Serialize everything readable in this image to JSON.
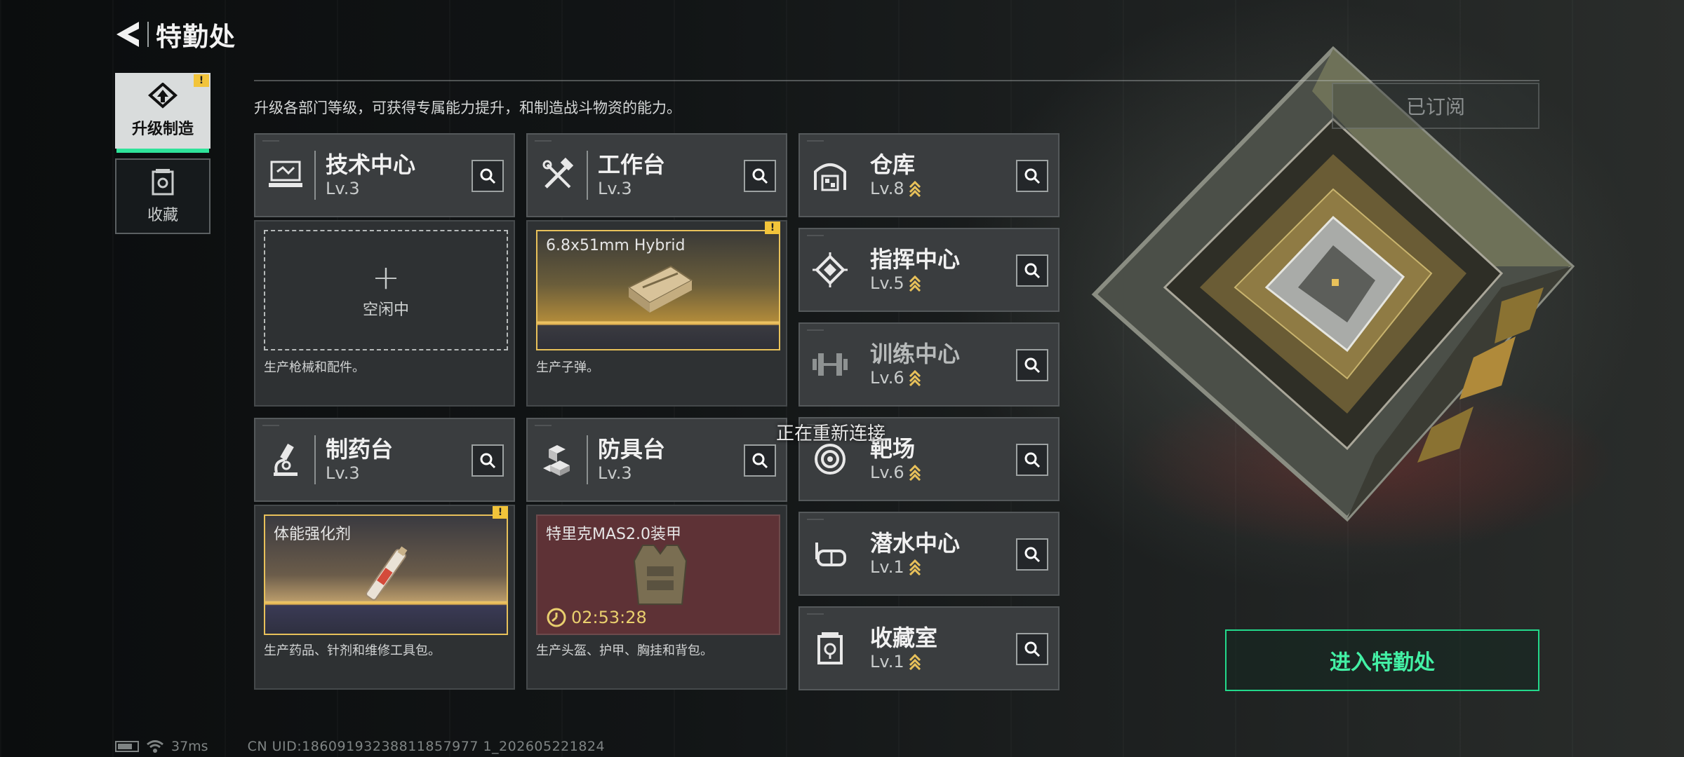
{
  "header": {
    "title": "特勤处"
  },
  "sidebar": {
    "items": [
      {
        "label": "升级制造",
        "active": true,
        "badge": "!"
      },
      {
        "label": "收藏",
        "active": false
      }
    ]
  },
  "description": "升级各部门等级，可获得专属能力提升，和制造战斗物资的能力。",
  "subscribe_button": "已订阅",
  "departments": {
    "tech_center": {
      "name": "技术中心",
      "level": "Lv.3",
      "slot_label": "空闲中",
      "desc": "生产枪械和配件。"
    },
    "workbench": {
      "name": "工作台",
      "level": "Lv.3",
      "slot_item": "6.8x51mm Hybrid",
      "desc": "生产子弹。"
    },
    "pharmacy": {
      "name": "制药台",
      "level": "Lv.3",
      "slot_item": "体能强化剂",
      "desc": "生产药品、针剂和维修工具包。"
    },
    "armor_bench": {
      "name": "防具台",
      "level": "Lv.3",
      "slot_item": "特里克MAS2.0装甲",
      "timer": "02:53:28",
      "desc": "生产头盔、护甲、胸挂和背包。"
    },
    "warehouse": {
      "name": "仓库",
      "level": "Lv.8"
    },
    "command_center": {
      "name": "指挥中心",
      "level": "Lv.5"
    },
    "training_center": {
      "name": "训练中心",
      "level": "Lv.6"
    },
    "shooting_range": {
      "name": "靶场",
      "level": "Lv.6"
    },
    "diving_center": {
      "name": "潜水中心",
      "level": "Lv.1"
    },
    "collection_room": {
      "name": "收藏室",
      "level": "Lv.1"
    }
  },
  "toast": "正在重新连接",
  "enter_button": "进入特勤处",
  "status": {
    "ping": "37ms",
    "uid": "CN UID:18609193238811857977 1_202605221824"
  },
  "colors": {
    "accent_green": "#2fe39a",
    "badge_yellow": "#f2c43a",
    "gold": "#e8c15a"
  }
}
